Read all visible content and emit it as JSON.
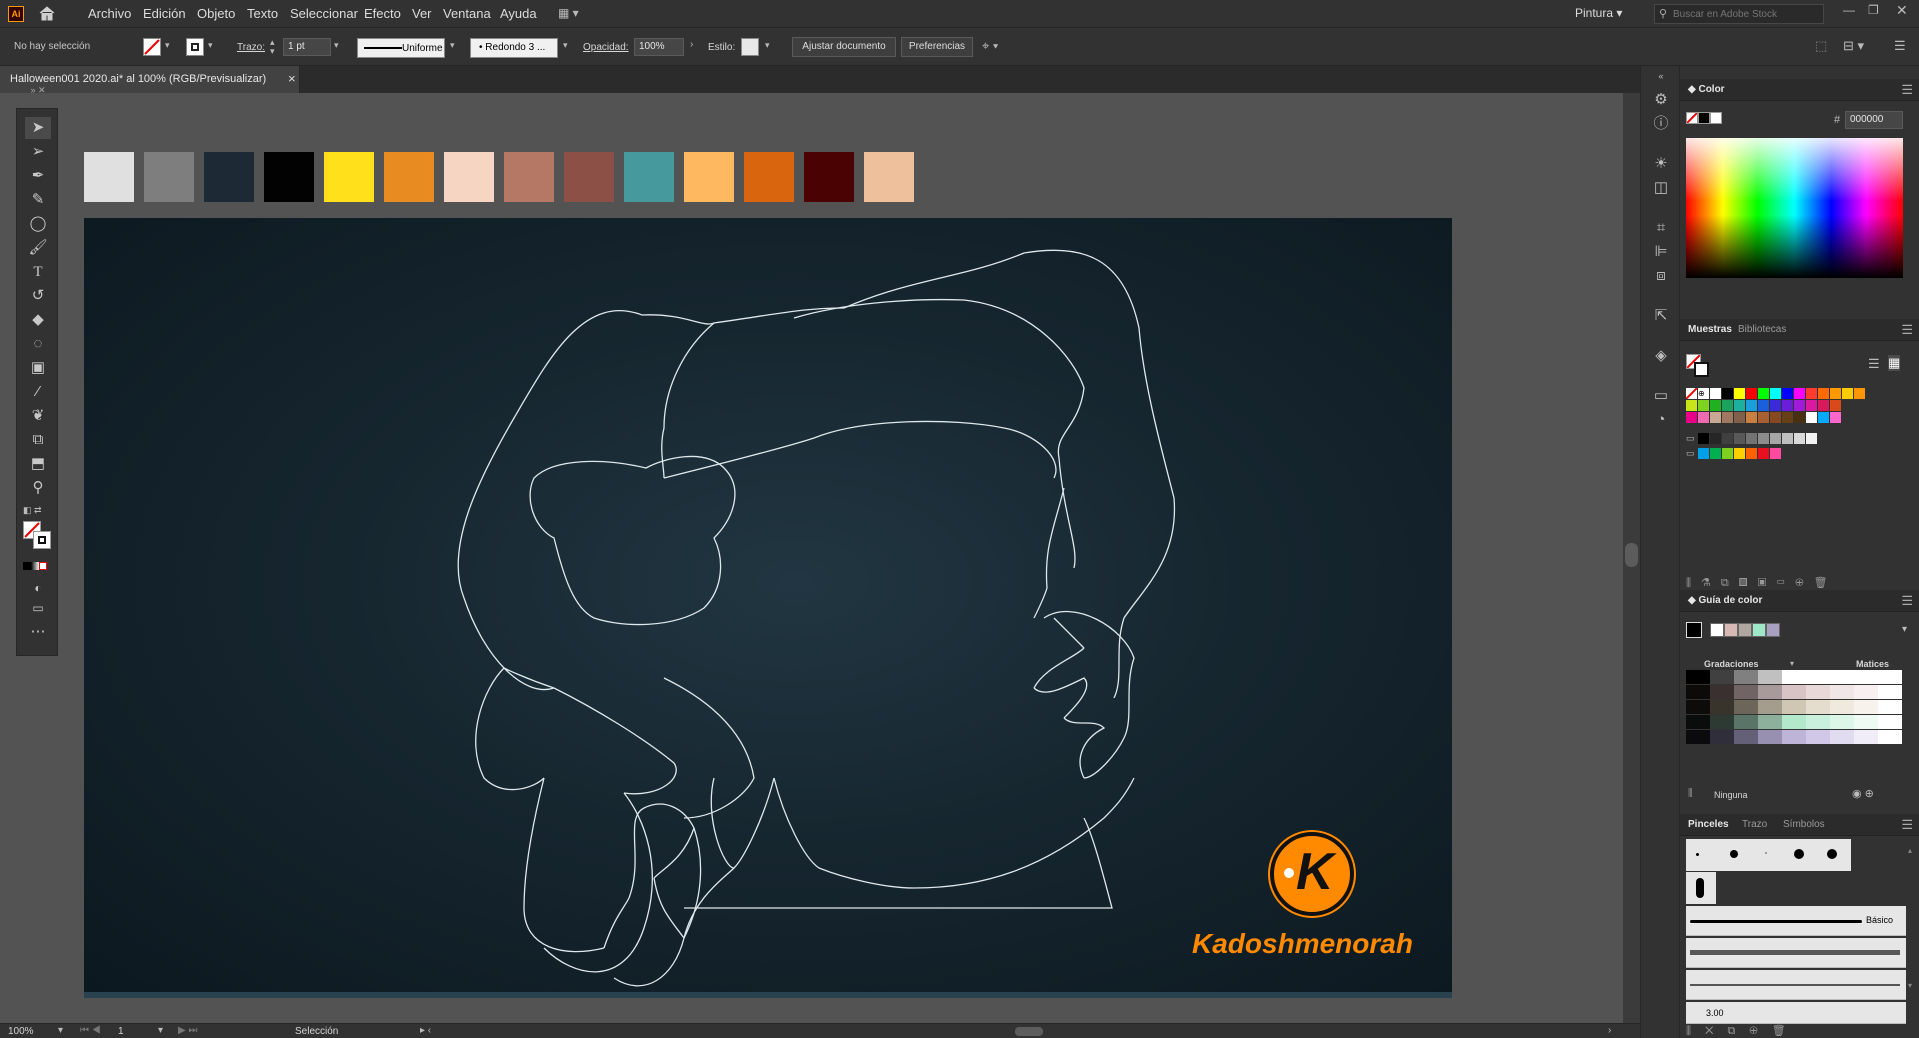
{
  "app": {
    "logo": "Ai"
  },
  "menu": [
    "Archivo",
    "Edición",
    "Objeto",
    "Texto",
    "Seleccionar",
    "Efecto",
    "Ver",
    "Ventana",
    "Ayuda"
  ],
  "workspace_label": "Pintura",
  "stock_search_placeholder": "Buscar en Adobe Stock",
  "control": {
    "selection_status": "No hay selección",
    "stroke_label": "Trazo:",
    "stroke_weight": "1 pt",
    "profile": "Uniforme",
    "brush": "Redondo 3 ...",
    "opacity_label": "Opacidad:",
    "opacity": "100%",
    "style_label": "Estilo:",
    "fit_doc_button": "Ajustar documento",
    "prefs_button": "Preferencias"
  },
  "document_tab": {
    "title": "Halloween001 2020.ai* al 100% (RGB/Previsualizar)",
    "close": "×"
  },
  "palette_colors": [
    "#e0e0e0",
    "#7e7e7e",
    "#1d2a36",
    "#020202",
    "#ffe01a",
    "#e88c22",
    "#f7d5c3",
    "#b57864",
    "#8c5047",
    "#46999c",
    "#fdb860",
    "#d9650f",
    "#4b0202",
    "#eec09b"
  ],
  "watermark": {
    "letter": "K",
    "text": "Kadoshmenorah",
    "color": "#ff8a00"
  },
  "status": {
    "zoom": "100%",
    "page": "1",
    "tool": "Selección"
  },
  "color_panel": {
    "title": "Color",
    "hash": "#",
    "hex": "000000"
  },
  "swatches_panel": {
    "tab_active": "Muestras",
    "tab_other": "Bibliotecas"
  },
  "swatch_rows": [
    [
      "#ffffff",
      "#000000",
      "#ffff00",
      "#ff0000",
      "#00ff00",
      "#00ffff",
      "#0000ff",
      "#ff00ff",
      "#ff3b30",
      "#ff6b00",
      "#ff9900",
      "#ffcc00",
      "#ff9500"
    ],
    [
      "#c6e619",
      "#7ed321",
      "#20b020",
      "#1aa35c",
      "#1bb0a0",
      "#1a9fdc",
      "#1a5fdc",
      "#3a2ad8",
      "#6a1ed8",
      "#a01ad8",
      "#d81aa0",
      "#d81a5a",
      "#d84a1a"
    ],
    [
      "#e8008a",
      "#f06ab2",
      "#c8a890",
      "#a07860",
      "#806048",
      "#c88040",
      "#a86030",
      "#884820",
      "#684018",
      "#483010",
      "#ffffff",
      "#00aaff",
      "#ff66cc"
    ]
  ],
  "swatch_grays": [
    "#000000",
    "#262626",
    "#404040",
    "#595959",
    "#737373",
    "#8c8c8c",
    "#a6a6a6",
    "#bfbfbf",
    "#d9d9d9",
    "#f2f2f2"
  ],
  "swatch_extra": [
    "#00a0e8",
    "#00b050",
    "#80d020",
    "#ffd000",
    "#ff6000",
    "#e81020",
    "#ff4aa0"
  ],
  "color_guide": {
    "title": "Guía de color",
    "left_label": "Gradaciones",
    "right_label": "Matices",
    "footer": "Ninguna"
  },
  "guide_harmony": [
    "#ffffff",
    "#d8b8b4",
    "#b0a8a0",
    "#9ee8c8",
    "#a8a0c0"
  ],
  "guide_grid": [
    [
      "#000000",
      "#404040",
      "#808080",
      "#c0c0c0",
      "#ffffff",
      "#ffffff",
      "#ffffff",
      "#ffffff",
      "#ffffff"
    ],
    [
      "#0d0a0a",
      "#3a3030",
      "#706464",
      "#a89a9a",
      "#d8c4c4",
      "#e8d8d8",
      "#f0e6e6",
      "#f8f0f0",
      "#ffffff"
    ],
    [
      "#0d0c0a",
      "#38342c",
      "#6c665a",
      "#a49c8c",
      "#d0c6b4",
      "#e4dccc",
      "#efe9de",
      "#f7f3ec",
      "#ffffff"
    ],
    [
      "#0a0d0b",
      "#2c3a33",
      "#5a7468",
      "#8cb09c",
      "#b4e8cc",
      "#c8f0dc",
      "#dcf6e8",
      "#eefbf4",
      "#ffffff"
    ],
    [
      "#0b0a0d",
      "#302e3a",
      "#646078",
      "#9890b0",
      "#beb4d8",
      "#d0c8e6",
      "#e2dcf0",
      "#f0ecf8",
      "#ffffff"
    ]
  ],
  "brushes_panel": {
    "tab_active": "Pinceles",
    "tab2": "Trazo",
    "tab3": "Símbolos",
    "basic_label": "Básico",
    "size_label": "3.00"
  }
}
